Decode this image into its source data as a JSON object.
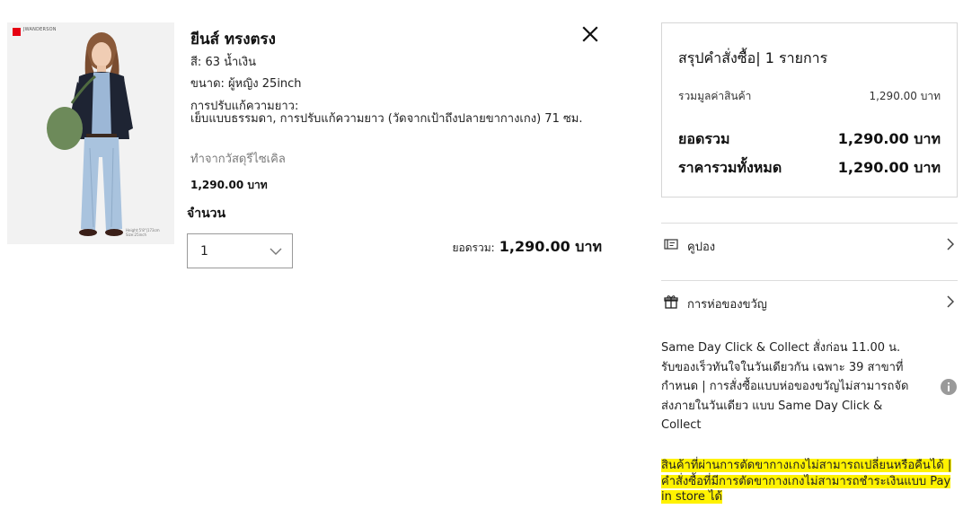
{
  "product": {
    "image": {
      "brand_mark": "JWANDERSON",
      "model_caption": [
        "Height:5'8\"|173cm",
        "Size:25inch"
      ]
    },
    "name": "ยีนส์ ทรงตรง",
    "color": "สี: 63 น้ำเงิน",
    "size": "ขนาด: ผู้หญิง 25inch",
    "alteration_label": "การปรับแก้ความยาว:",
    "alteration_value": "เย็บแบบธรรมดา, การปรับแก้ความยาว (วัดจากเป้าถึงปลายขากางเกง) 71 ซม.",
    "recycled_note": "ทำจากวัสดุรีไซเคิล",
    "price": "1,290.00 บาท",
    "quantity_label": "จำนวน",
    "quantity_value": "1",
    "subtotal_label": "ยอดรวม:",
    "subtotal_value": "1,290.00 บาท",
    "close_icon": "close-icon"
  },
  "summary": {
    "title": "สรุปคำสั่งซื้อ| 1 รายการ",
    "merchandise_label": "รวมมูลค่าสินค้า",
    "merchandise_value": "1,290.00 บาท",
    "subtotal_label": "ยอดรวม",
    "subtotal_value": "1,290.00 บาท",
    "total_label": "ราคารวมทั้งหมด",
    "total_value": "1,290.00 บาท"
  },
  "menu": {
    "coupon": {
      "label": "คูปอง",
      "icon": "coupon-icon"
    },
    "gift": {
      "label": "การห่อของขวัญ",
      "icon": "gift-icon"
    }
  },
  "info": {
    "same_day": "Same Day Click & Collect สั่งก่อน 11.00 น. รับของเร็วทันใจในวันเดียวกัน เฉพาะ 39 สาขาที่กำหนด | การสั่งซื้อแบบห่อของขวัญไม่สามารถจัดส่งภายในวันเดียว แบบ Same Day Click & Collect",
    "warning": "สินค้าที่ผ่านการตัดขากางเกงไม่สามารถเปลี่ยนหรือคืนได้ | คำสั่งซื้อที่มีการตัดขากางเกงไม่สามารถชำระเงินแบบ Pay in store ได้"
  },
  "colors": {
    "highlight": "#fff200",
    "border": "#d6d6d6",
    "text": "#1b1b1b",
    "muted": "#7a7a7a"
  }
}
